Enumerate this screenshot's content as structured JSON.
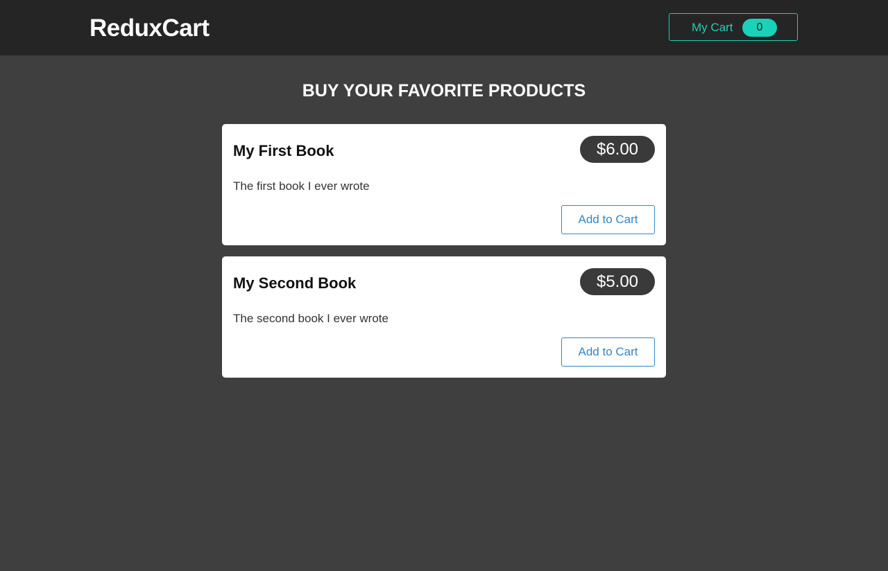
{
  "header": {
    "brand": "ReduxCart",
    "cart": {
      "label": "My Cart",
      "count": "0"
    }
  },
  "main": {
    "title": "BUY YOUR FAVORITE PRODUCTS",
    "products": [
      {
        "title": "My First Book",
        "price": "$6.00",
        "description": "The first book I ever wrote",
        "button_label": "Add to Cart"
      },
      {
        "title": "My Second Book",
        "price": "$5.00",
        "description": "The second book I ever wrote",
        "button_label": "Add to Cart"
      }
    ]
  },
  "colors": {
    "page_background": "#3f3f3f",
    "header_background": "#252525",
    "accent_teal": "#1ad1b9",
    "button_blue": "#2f86c9",
    "price_badge": "#3a3a3a"
  }
}
